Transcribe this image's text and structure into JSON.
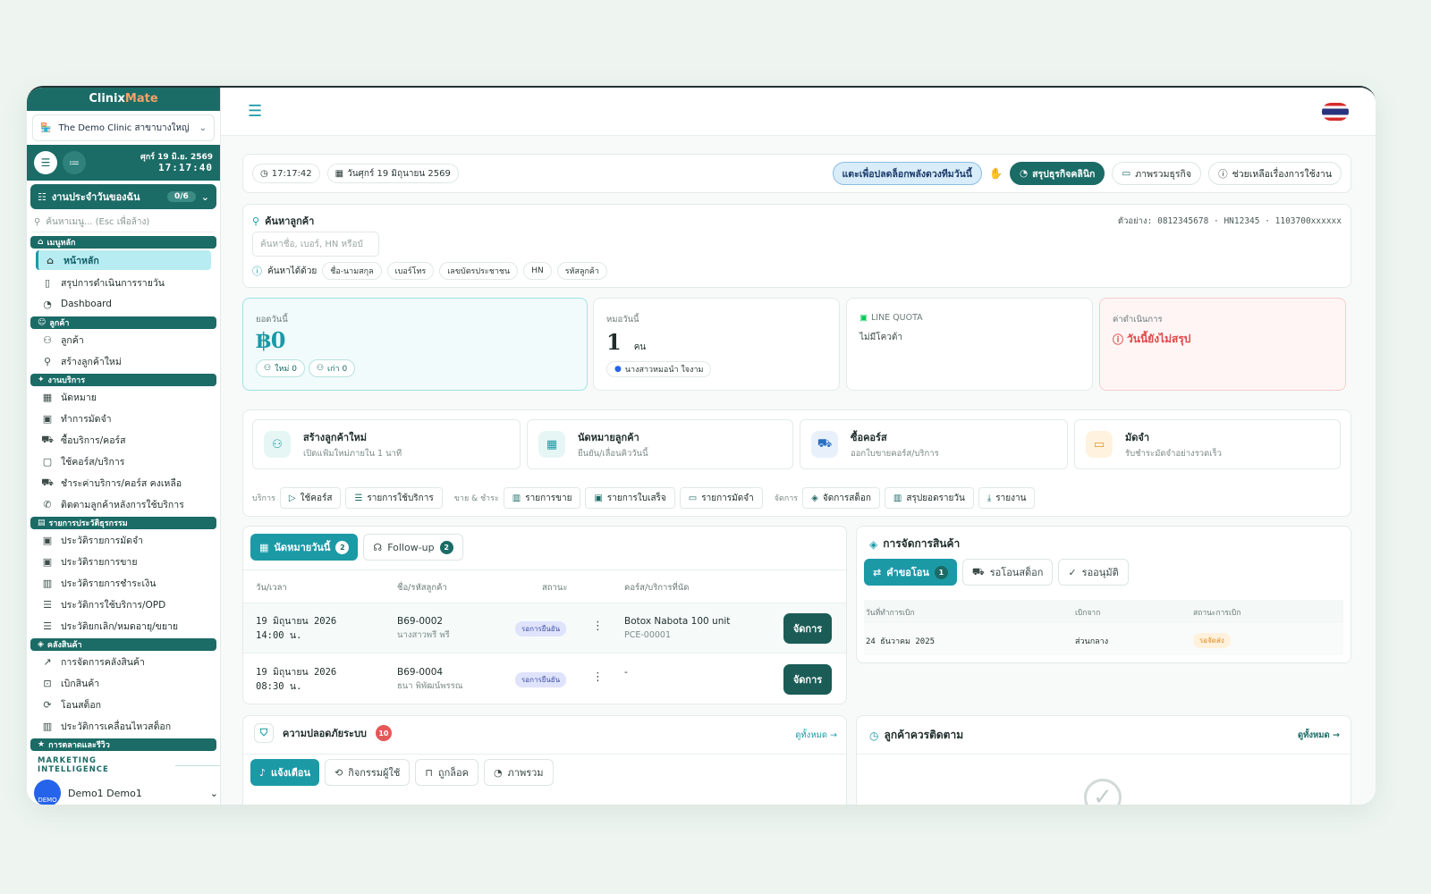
{
  "sidebar": {
    "brand_a": "Clinix",
    "brand_b": "Mate",
    "clinic": "The Demo Clinic สาขาบางใหญ่",
    "date": "ศุกร์ 19 มิ.ย. 2569",
    "time": "17:17:40",
    "tasks_label": "งานประจำวันของฉัน",
    "tasks_badge": "0/6",
    "search_placeholder": "ค้นหาเมนู... (Esc เพื่อล้าง)",
    "sections": [
      {
        "title": "เมนูหลัก",
        "items": [
          "หน้าหลัก",
          "สรุปการดำเนินการรายวัน",
          "Dashboard"
        ]
      },
      {
        "title": "ลูกค้า",
        "items": [
          "ลูกค้า",
          "สร้างลูกค้าใหม่"
        ]
      },
      {
        "title": "งานบริการ",
        "items": [
          "นัดหมาย",
          "ทำการมัดจำ",
          "ซื้อบริการ/คอร์ส",
          "ใช้คอร์ส/บริการ",
          "ชำระค่าบริการ/คอร์ส คงเหลือ",
          "ติดตามลูกค้าหลังการใช้บริการ"
        ]
      },
      {
        "title": "รายการประวัติธุรกรรม",
        "items": [
          "ประวัติรายการมัดจำ",
          "ประวัติรายการขาย",
          "ประวัติรายการชำระเงิน",
          "ประวัติการใช้บริการ/OPD",
          "ประวัติยกเลิก/หมดอายุ/ขยาย"
        ]
      },
      {
        "title": "คลังสินค้า",
        "items": [
          "การจัดการคลังสินค้า",
          "เบิกสินค้า",
          "โอนสต็อก",
          "ประวัติการเคลื่อนไหวสต็อก"
        ]
      },
      {
        "title": "การตลาดและรีวิว",
        "items": []
      }
    ],
    "marketing": "MARKETING INTELLIGENCE",
    "user_name": "Demo1 Demo1",
    "avatar_text": "DEMO"
  },
  "header": {
    "time": "17:17:42",
    "date": "วันศุกร์ 19 มิถุนายน 2569",
    "unlock": "แตะเพื่อปลดล็อกพลังดวงทีมวันนี้",
    "summary_btn": "สรุปธุรกิจคลินิก",
    "overview_btn": "ภาพรวมธุรกิจ",
    "help_btn": "ช่วยเหลือเรื่องการใช้งาน"
  },
  "search": {
    "title": "ค้นหาลูกค้า",
    "example": "ตัวอย่าง: 0812345678 · HN12345 · 1103700xxxxxx",
    "placeholder": "ค้นหาชื่อ, เบอร์, HN หรือบั",
    "by_label": "ค้นหาได้ด้วย",
    "by": [
      "ชื่อ-นามสกุล",
      "เบอร์โทร",
      "เลขบัตรประชาชน",
      "HN",
      "รหัสลูกค้า"
    ]
  },
  "stats": {
    "sales_label": "ยอดวันนี้",
    "sales_value": "฿0",
    "new_label": "ใหม่ 0",
    "old_label": "เก่า 0",
    "doctor_label": "หมอวันนี้",
    "doctor_count": "1",
    "doctor_unit": "คน",
    "doctor_name": "นางสาวหมอนำ ใจงาม",
    "line_label": "LINE QUOTA",
    "line_value": "ไม่มีโควต้า",
    "ops_label": "ค่าดำเนินการ",
    "ops_value": "วันนี้ยังไม่สรุป"
  },
  "quick": [
    {
      "title": "สร้างลูกค้าใหม่",
      "sub": "เปิดแฟ้มใหม่ภายใน 1 นาที"
    },
    {
      "title": "นัดหมายลูกค้า",
      "sub": "ยืนยัน/เลื่อนคิววันนี้"
    },
    {
      "title": "ซื้อคอร์ส",
      "sub": "ออกใบขายคอร์ส/บริการ"
    },
    {
      "title": "มัดจำ",
      "sub": "รับชำระมัดจำอย่างรวดเร็ว"
    }
  ],
  "shortcuts": {
    "service_label": "บริการ",
    "sale_label": "ขาย & ชำระ",
    "manage_label": "จัดการ",
    "service": [
      "ใช้คอร์ส",
      "รายการใช้บริการ"
    ],
    "sale": [
      "รายการขาย",
      "รายการใบเสร็จ",
      "รายการมัดจำ"
    ],
    "manage": [
      "จัดการสต็อก",
      "สรุปยอดรายวัน",
      "รายงาน"
    ]
  },
  "appointments": {
    "tab_today": "นัดหมายวันนี้",
    "tab_today_count": "2",
    "tab_followup": "Follow-up",
    "tab_followup_count": "2",
    "headers": [
      "วัน/เวลา",
      "ชื่อ/รหัสลูกค้า",
      "สถานะ",
      "คอร์ส/บริการที่นัด"
    ],
    "rows": [
      {
        "date": "19 มิถุนายน 2026",
        "time": "14:00 น.",
        "code": "B69-0002",
        "name": "นางสาวพรี พรี",
        "status": "รอการยืนยัน",
        "service": "Botox Nabota 100 unit",
        "service_code": "PCE-00001",
        "action": "จัดการ"
      },
      {
        "date": "19 มิถุนายน 2026",
        "time": "08:30 น.",
        "code": "B69-0004",
        "name": "ธนา พิพัฒน์พรรณ",
        "status": "รอการยืนยัน",
        "service": "-",
        "service_code": "",
        "action": "จัดการ"
      }
    ]
  },
  "inventory": {
    "title": "การจัดการสินค้า",
    "tab_request": "คำขอโอน",
    "tab_request_count": "1",
    "tab_wait_transfer": "รอโอนสต็อก",
    "tab_wait_approve": "รออนุมัติ",
    "headers": [
      "วันที่ทำการเบิก",
      "เบิกจาก",
      "สถานะการเบิก"
    ],
    "rows": [
      {
        "date": "24 ธันวาคม 2025",
        "from": "ส่วนกลาง",
        "status": "รอจัดส่ง"
      }
    ]
  },
  "security": {
    "title": "ความปลอดภัยระบบ",
    "count": "10",
    "view_all": "ดูทั้งหมด →",
    "tabs": [
      "แจ้งเตือน",
      "กิจกรรมผู้ใช้",
      "ถูกล็อค",
      "ภาพรวม"
    ]
  },
  "followup": {
    "title": "ลูกค้าควรติดตาม",
    "view_all": "ดูทั้งหมด →"
  }
}
